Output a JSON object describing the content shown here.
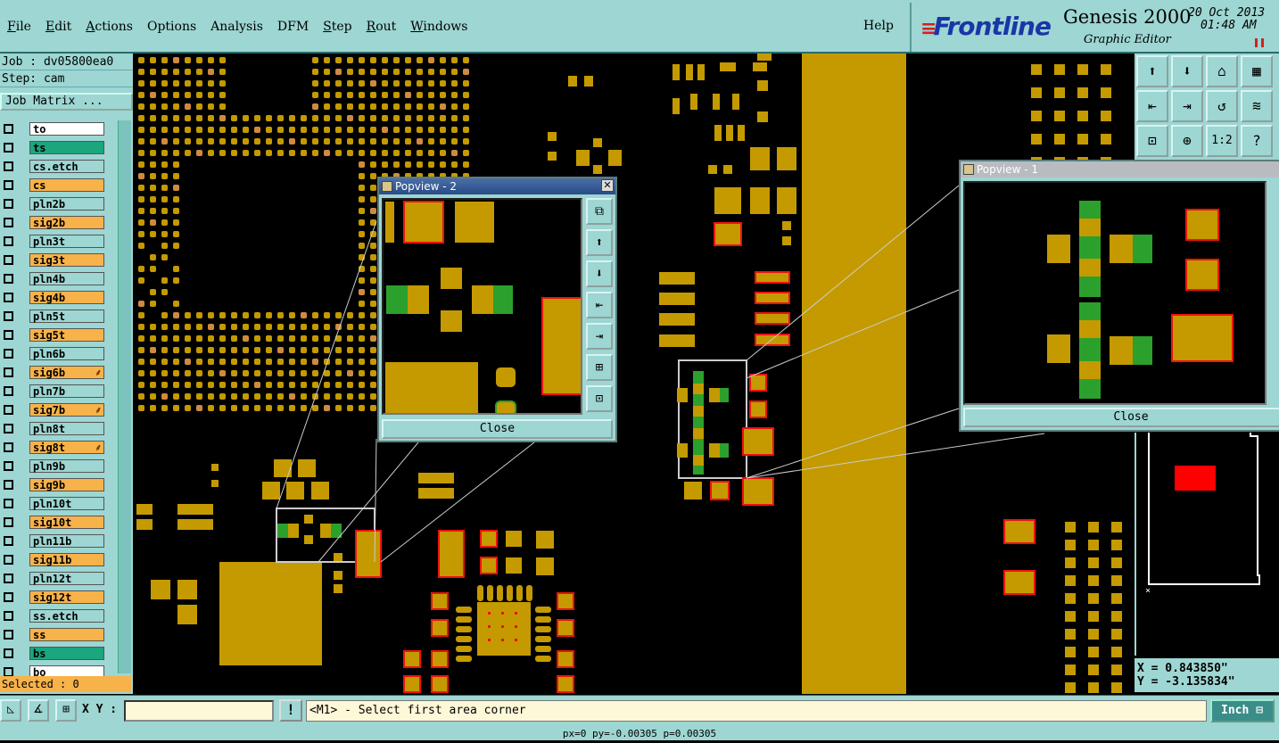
{
  "menubar": {
    "items": [
      "File",
      "Edit",
      "Actions",
      "Options",
      "Analysis",
      "DFM",
      "Step",
      "Rout",
      "Windows"
    ],
    "help": "Help"
  },
  "brand": {
    "logo": "Frontline",
    "title": "Genesis 2000",
    "subtitle": "Graphic Editor",
    "date": "20 Oct 2013",
    "time": "01:48 AM"
  },
  "job": {
    "job_line": "Job : dv05800ea0",
    "step_line": "Step: cam",
    "matrix_button": "Job Matrix ..."
  },
  "layers": [
    {
      "name": "to",
      "color": "w"
    },
    {
      "name": "ts",
      "color": "g"
    },
    {
      "name": "cs.etch",
      "color": "c"
    },
    {
      "name": "cs",
      "color": "o"
    },
    {
      "name": "pln2b",
      "color": "c"
    },
    {
      "name": "sig2b",
      "color": "o"
    },
    {
      "name": "pln3t",
      "color": "c"
    },
    {
      "name": "sig3t",
      "color": "o"
    },
    {
      "name": "pln4b",
      "color": "c"
    },
    {
      "name": "sig4b",
      "color": "o"
    },
    {
      "name": "pln5t",
      "color": "c"
    },
    {
      "name": "sig5t",
      "color": "o"
    },
    {
      "name": "pln6b",
      "color": "c"
    },
    {
      "name": "sig6b",
      "color": "o",
      "feature": "true"
    },
    {
      "name": "pln7b",
      "color": "c"
    },
    {
      "name": "sig7b",
      "color": "o",
      "feature": "true"
    },
    {
      "name": "pln8t",
      "color": "c"
    },
    {
      "name": "sig8t",
      "color": "o",
      "feature": "true"
    },
    {
      "name": "pln9b",
      "color": "c"
    },
    {
      "name": "sig9b",
      "color": "o"
    },
    {
      "name": "pln10t",
      "color": "c"
    },
    {
      "name": "sig10t",
      "color": "o"
    },
    {
      "name": "pln11b",
      "color": "c"
    },
    {
      "name": "sig11b",
      "color": "o"
    },
    {
      "name": "pln12t",
      "color": "c"
    },
    {
      "name": "sig12t",
      "color": "o"
    },
    {
      "name": "ss.etch",
      "color": "c"
    },
    {
      "name": "ss",
      "color": "o"
    },
    {
      "name": "bs",
      "color": "g"
    },
    {
      "name": "bo",
      "color": "w"
    }
  ],
  "selected": "Selected : 0",
  "popview2": {
    "title": "Popview - 2",
    "close": "Close"
  },
  "popview1": {
    "title": "Popview - 1",
    "close": "Close"
  },
  "coords": {
    "x": "X = 0.843850\"",
    "y": "Y = -3.135834\""
  },
  "status": {
    "xy_label": "X Y :",
    "xy_value": "",
    "prompt": "<M1> - Select first area corner",
    "unit": "Inch",
    "bottom": "px=0 py=-0.00305 p=0.00305"
  },
  "colors": {
    "pad": "#c49a00",
    "green": "#2ca02c",
    "outline": "#e11",
    "bg": "#000"
  }
}
